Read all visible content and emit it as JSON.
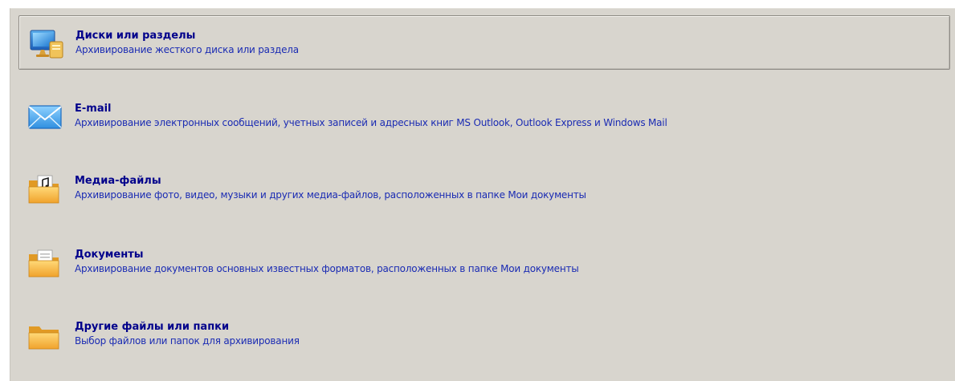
{
  "options": [
    {
      "icon": "computer-monitor-icon",
      "title": "Диски или разделы",
      "description": "Архивирование жесткого диска или раздела",
      "selected": true
    },
    {
      "icon": "envelope-icon",
      "title": "E-mail",
      "description": "Архивирование электронных сообщений, учетных записей и адресных книг MS Outlook, Outlook Express и Windows Mail",
      "selected": false
    },
    {
      "icon": "media-folder-icon",
      "title": "Медиа-файлы",
      "description": "Архивирование фото, видео, музыки и других медиа-файлов, расположенных в папке Мои документы",
      "selected": false
    },
    {
      "icon": "documents-folder-icon",
      "title": "Документы",
      "description": "Архивирование документов основных известных форматов, расположенных в папке Мои документы",
      "selected": false
    },
    {
      "icon": "folder-icon",
      "title": "Другие файлы или папки",
      "description": "Выбор файлов или папок для архивирования",
      "selected": false
    }
  ],
  "colors": {
    "panel_background": "#d8d5ce",
    "title_text": "#00008b",
    "description_text": "#1a2bb3",
    "folder_yellow": "#f5b94a",
    "envelope_blue": "#4aa8e8"
  }
}
